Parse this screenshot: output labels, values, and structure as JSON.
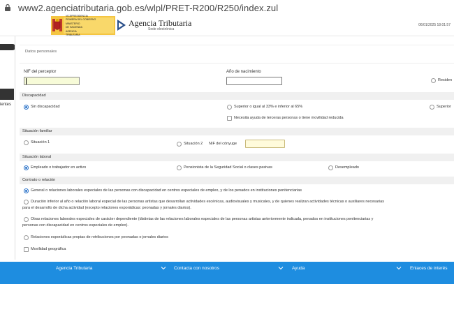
{
  "browser": {
    "url": "www2.agenciatributaria.gob.es/wlpl/PRET-R200/R250/index.zul"
  },
  "header": {
    "gov_lines": [
      "VICEPRESIDENCIA",
      "PRIMERA DEL GOBIERNO",
      "MINISTERIO",
      "DE HACIENDA",
      "AGENCIA",
      "TRIBUTARIA"
    ],
    "agency_name": "Agencia Tributaria",
    "agency_sub": "Sede electrónica",
    "datetime": "06/01/2025 18:01:57"
  },
  "sidebar": {
    "partial_text": "ientes"
  },
  "datos_personales": {
    "title": "Datos personales",
    "nif_label": "NIF del perceptor",
    "nif_value": "",
    "birth_label": "Año de nacimiento",
    "birth_value": "",
    "residence_label": "Residen"
  },
  "discapacidad": {
    "title": "Discapacidad",
    "options": [
      "Sin discapacidad",
      "Superior o igual al 33% e inferior al 65%",
      "Superior"
    ],
    "selected": "Sin discapacidad",
    "help_check_label": "Necesita ayuda de terceras personas o tiene movilidad reducida"
  },
  "situacion_familiar": {
    "title": "Situación familiar",
    "option1": "Situación 1",
    "option2": "Situación 2",
    "spouse_nif_label": "NIF del cónyuge",
    "spouse_nif_value": ""
  },
  "situacion_laboral": {
    "title": "Situación laboral",
    "options": [
      "Empleado o trabajador en activo",
      "Pensionista de la Seguridad Social o clases pasivas",
      "Desempleado"
    ],
    "selected": "Empleado o trabajador en activo"
  },
  "contrato": {
    "title": "Contrato o relación",
    "opt1": "General o relaciones laborales especiales de las personas con discapacidad en centros especiales de empleo, y de los penados en instituciones penitenciarias",
    "opt2_line1": "Duración inferior al año o relación laboral especial de las personas artistas que desarrollan actividades escénicas, audiovisuales y musicales, y de quienes realizan actividades técnicas o auxiliares necesarias",
    "opt2_line2": "para el desarrollo de dicha actividad (excepto relaciones esporádicas: peonadas y jornales diarios).",
    "opt3_line1": "Otras relaciones laborales especiales de carácter dependiente (distintas de las relaciones laborales especiales de las personas artistas anteriormente indicada, penados en instituciones penitenciarias y",
    "opt3_line2": "personas con discapacidad en centros especiales de empleo).",
    "opt4": "Relaciones esporádicas propias de retribuciones por peonadas o jornales diarios",
    "mobility_label": "Movilidad geográfica",
    "selected": "opt1"
  },
  "footer": {
    "items": [
      "Agencia Tributaria",
      "Contacta con nosotros",
      "Ayuda",
      "Enlaces de interés"
    ]
  },
  "colors": {
    "footer_bg": "#1e8de0",
    "radio_accent": "#2a72c9",
    "section_bg": "#f0f0f0"
  }
}
